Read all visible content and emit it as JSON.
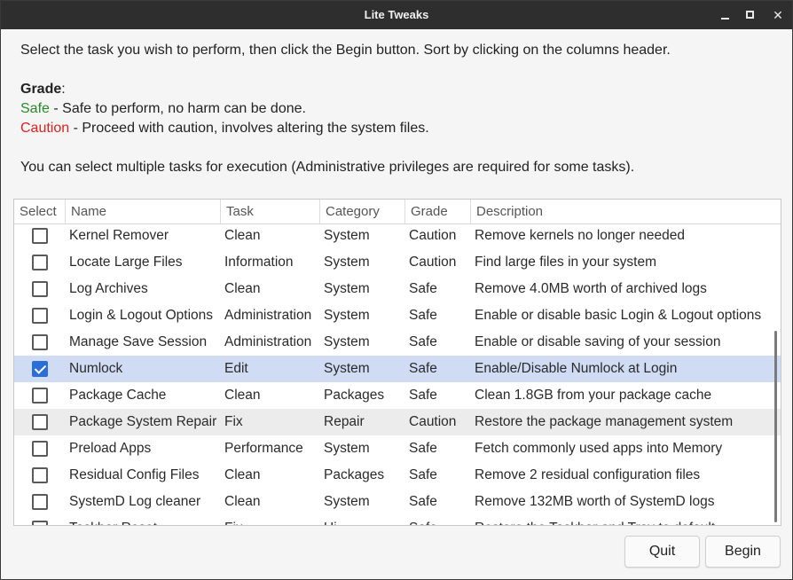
{
  "window": {
    "title": "Lite Tweaks"
  },
  "intro": {
    "line1": "Select the task you wish to perform, then click the Begin button. Sort by clicking on the columns header.",
    "grade_label": "Grade",
    "grade_colon": ":",
    "safe_word": "Safe",
    "safe_desc": " - Safe to perform, no harm can be done.",
    "caution_word": "Caution",
    "caution_desc": " - Proceed with caution, involves altering the system files.",
    "multi": "You can select multiple tasks for execution (Administrative privileges are required for some tasks)."
  },
  "table": {
    "headers": [
      "Select",
      "Name",
      "Task",
      "Category",
      "Grade",
      "Description"
    ],
    "rows": [
      {
        "checked": false,
        "name": "Kernel Remover",
        "task": "Clean",
        "category": "System",
        "grade": "Caution",
        "description": "Remove kernels no longer needed"
      },
      {
        "checked": false,
        "name": "Locate Large Files",
        "task": "Information",
        "category": "System",
        "grade": "Caution",
        "description": "Find large files in your system"
      },
      {
        "checked": false,
        "name": "Log Archives",
        "task": "Clean",
        "category": "System",
        "grade": "Safe",
        "description": "Remove 4.0MB worth of archived logs"
      },
      {
        "checked": false,
        "name": "Login & Logout Options",
        "task": "Administration",
        "category": "System",
        "grade": "Safe",
        "description": "Enable or disable basic Login & Logout options"
      },
      {
        "checked": false,
        "name": "Manage Save Session",
        "task": "Administration",
        "category": "System",
        "grade": "Safe",
        "description": "Enable or disable saving of your session"
      },
      {
        "checked": true,
        "name": "Numlock",
        "task": "Edit",
        "category": "System",
        "grade": "Safe",
        "description": "Enable/Disable Numlock at Login"
      },
      {
        "checked": false,
        "name": "Package Cache",
        "task": "Clean",
        "category": "Packages",
        "grade": "Safe",
        "description": "Clean 1.8GB from your package cache"
      },
      {
        "checked": false,
        "name": "Package System Repair",
        "task": "Fix",
        "category": "Repair",
        "grade": "Caution",
        "description": "Restore the package management system"
      },
      {
        "checked": false,
        "name": "Preload Apps",
        "task": "Performance",
        "category": "System",
        "grade": "Safe",
        "description": "Fetch commonly used apps into Memory"
      },
      {
        "checked": false,
        "name": "Residual Config Files",
        "task": "Clean",
        "category": "Packages",
        "grade": "Safe",
        "description": "Remove 2 residual configuration files"
      },
      {
        "checked": false,
        "name": "SystemD Log cleaner",
        "task": "Clean",
        "category": "System",
        "grade": "Safe",
        "description": "Remove 132MB worth of SystemD logs"
      },
      {
        "checked": false,
        "name": "Taskbar Reset",
        "task": "Fix",
        "category": "Ui",
        "grade": "Safe",
        "description": "Restore the Taskbar and Tray to default"
      }
    ]
  },
  "buttons": {
    "quit": "Quit",
    "begin": "Begin"
  }
}
